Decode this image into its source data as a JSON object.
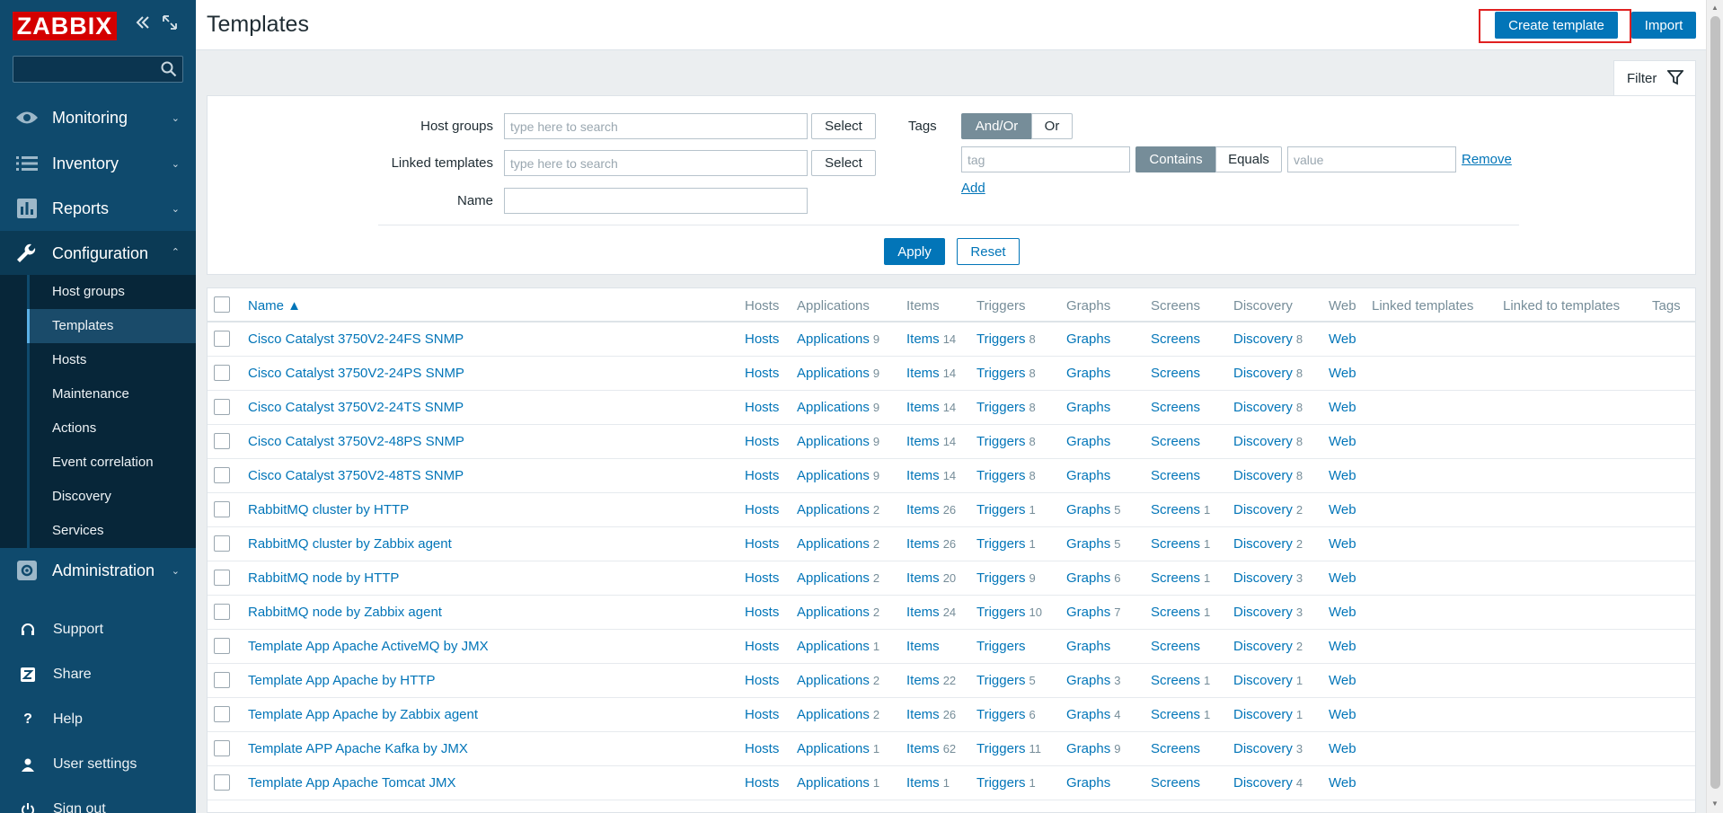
{
  "app": {
    "logo_text": "ZABBIX",
    "brand_color": "#d40000",
    "accent_color": "#0275b8"
  },
  "sidebar": {
    "collapse_icon": "double-chevron-left-icon",
    "kiosk_icon": "kiosk-mode-icon",
    "search_placeholder": "",
    "main_items": [
      {
        "label": "Monitoring",
        "icon": "eye-icon"
      },
      {
        "label": "Inventory",
        "icon": "list-icon"
      },
      {
        "label": "Reports",
        "icon": "bar-chart-icon"
      },
      {
        "label": "Configuration",
        "icon": "wrench-icon"
      },
      {
        "label": "Administration",
        "icon": "gear-icon"
      }
    ],
    "config_submenu": [
      "Host groups",
      "Templates",
      "Hosts",
      "Maintenance",
      "Actions",
      "Event correlation",
      "Discovery",
      "Services"
    ],
    "selected_submenu": "Templates",
    "bottom_items": [
      {
        "label": "Support",
        "icon": "headset-icon"
      },
      {
        "label": "Share",
        "icon": "share-z-icon"
      },
      {
        "label": "Help",
        "icon": "question-icon"
      },
      {
        "label": "User settings",
        "icon": "user-icon"
      },
      {
        "label": "Sign out",
        "icon": "power-icon"
      }
    ]
  },
  "header": {
    "title": "Templates",
    "create_label": "Create template",
    "import_label": "Import"
  },
  "filter": {
    "tab_label": "Filter",
    "host_groups_label": "Host groups",
    "host_groups_placeholder": "type here to search",
    "linked_templates_label": "Linked templates",
    "linked_templates_placeholder": "type here to search",
    "name_label": "Name",
    "name_value": "",
    "select_label": "Select",
    "tags_label": "Tags",
    "andor_label": "And/Or",
    "or_label": "Or",
    "tag_placeholder": "tag",
    "contains_label": "Contains",
    "equals_label": "Equals",
    "value_placeholder": "value",
    "remove_label": "Remove",
    "add_label": "Add",
    "apply_label": "Apply",
    "reset_label": "Reset"
  },
  "table": {
    "columns": {
      "name": "Name ▲",
      "hosts": "Hosts",
      "applications": "Applications",
      "items": "Items",
      "triggers": "Triggers",
      "graphs": "Graphs",
      "screens": "Screens",
      "discovery": "Discovery",
      "web": "Web",
      "linked_templates": "Linked templates",
      "linked_to_templates": "Linked to templates",
      "tags": "Tags"
    },
    "rows": [
      {
        "name": "Cisco Catalyst 3750V2-24FS SNMP",
        "hosts": "Hosts",
        "applications": "Applications",
        "applications_count": "9",
        "items": "Items",
        "items_count": "14",
        "triggers": "Triggers",
        "triggers_count": "8",
        "graphs": "Graphs",
        "graphs_count": "",
        "screens": "Screens",
        "screens_count": "",
        "discovery": "Discovery",
        "discovery_count": "8",
        "web": "Web"
      },
      {
        "name": "Cisco Catalyst 3750V2-24PS SNMP",
        "hosts": "Hosts",
        "applications": "Applications",
        "applications_count": "9",
        "items": "Items",
        "items_count": "14",
        "triggers": "Triggers",
        "triggers_count": "8",
        "graphs": "Graphs",
        "graphs_count": "",
        "screens": "Screens",
        "screens_count": "",
        "discovery": "Discovery",
        "discovery_count": "8",
        "web": "Web"
      },
      {
        "name": "Cisco Catalyst 3750V2-24TS SNMP",
        "hosts": "Hosts",
        "applications": "Applications",
        "applications_count": "9",
        "items": "Items",
        "items_count": "14",
        "triggers": "Triggers",
        "triggers_count": "8",
        "graphs": "Graphs",
        "graphs_count": "",
        "screens": "Screens",
        "screens_count": "",
        "discovery": "Discovery",
        "discovery_count": "8",
        "web": "Web"
      },
      {
        "name": "Cisco Catalyst 3750V2-48PS SNMP",
        "hosts": "Hosts",
        "applications": "Applications",
        "applications_count": "9",
        "items": "Items",
        "items_count": "14",
        "triggers": "Triggers",
        "triggers_count": "8",
        "graphs": "Graphs",
        "graphs_count": "",
        "screens": "Screens",
        "screens_count": "",
        "discovery": "Discovery",
        "discovery_count": "8",
        "web": "Web"
      },
      {
        "name": "Cisco Catalyst 3750V2-48TS SNMP",
        "hosts": "Hosts",
        "applications": "Applications",
        "applications_count": "9",
        "items": "Items",
        "items_count": "14",
        "triggers": "Triggers",
        "triggers_count": "8",
        "graphs": "Graphs",
        "graphs_count": "",
        "screens": "Screens",
        "screens_count": "",
        "discovery": "Discovery",
        "discovery_count": "8",
        "web": "Web"
      },
      {
        "name": "RabbitMQ cluster by HTTP",
        "hosts": "Hosts",
        "applications": "Applications",
        "applications_count": "2",
        "items": "Items",
        "items_count": "26",
        "triggers": "Triggers",
        "triggers_count": "1",
        "graphs": "Graphs",
        "graphs_count": "5",
        "screens": "Screens",
        "screens_count": "1",
        "discovery": "Discovery",
        "discovery_count": "2",
        "web": "Web"
      },
      {
        "name": "RabbitMQ cluster by Zabbix agent",
        "hosts": "Hosts",
        "applications": "Applications",
        "applications_count": "2",
        "items": "Items",
        "items_count": "26",
        "triggers": "Triggers",
        "triggers_count": "1",
        "graphs": "Graphs",
        "graphs_count": "5",
        "screens": "Screens",
        "screens_count": "1",
        "discovery": "Discovery",
        "discovery_count": "2",
        "web": "Web"
      },
      {
        "name": "RabbitMQ node by HTTP",
        "hosts": "Hosts",
        "applications": "Applications",
        "applications_count": "2",
        "items": "Items",
        "items_count": "20",
        "triggers": "Triggers",
        "triggers_count": "9",
        "graphs": "Graphs",
        "graphs_count": "6",
        "screens": "Screens",
        "screens_count": "1",
        "discovery": "Discovery",
        "discovery_count": "3",
        "web": "Web"
      },
      {
        "name": "RabbitMQ node by Zabbix agent",
        "hosts": "Hosts",
        "applications": "Applications",
        "applications_count": "2",
        "items": "Items",
        "items_count": "24",
        "triggers": "Triggers",
        "triggers_count": "10",
        "graphs": "Graphs",
        "graphs_count": "7",
        "screens": "Screens",
        "screens_count": "1",
        "discovery": "Discovery",
        "discovery_count": "3",
        "web": "Web"
      },
      {
        "name": "Template App Apache ActiveMQ by JMX",
        "hosts": "Hosts",
        "applications": "Applications",
        "applications_count": "1",
        "items": "Items",
        "items_count": "",
        "triggers": "Triggers",
        "triggers_count": "",
        "graphs": "Graphs",
        "graphs_count": "",
        "screens": "Screens",
        "screens_count": "",
        "discovery": "Discovery",
        "discovery_count": "2",
        "web": "Web"
      },
      {
        "name": "Template App Apache by HTTP",
        "hosts": "Hosts",
        "applications": "Applications",
        "applications_count": "2",
        "items": "Items",
        "items_count": "22",
        "triggers": "Triggers",
        "triggers_count": "5",
        "graphs": "Graphs",
        "graphs_count": "3",
        "screens": "Screens",
        "screens_count": "1",
        "discovery": "Discovery",
        "discovery_count": "1",
        "web": "Web"
      },
      {
        "name": "Template App Apache by Zabbix agent",
        "hosts": "Hosts",
        "applications": "Applications",
        "applications_count": "2",
        "items": "Items",
        "items_count": "26",
        "triggers": "Triggers",
        "triggers_count": "6",
        "graphs": "Graphs",
        "graphs_count": "4",
        "screens": "Screens",
        "screens_count": "1",
        "discovery": "Discovery",
        "discovery_count": "1",
        "web": "Web"
      },
      {
        "name": "Template APP Apache Kafka by JMX",
        "hosts": "Hosts",
        "applications": "Applications",
        "applications_count": "1",
        "items": "Items",
        "items_count": "62",
        "triggers": "Triggers",
        "triggers_count": "11",
        "graphs": "Graphs",
        "graphs_count": "9",
        "screens": "Screens",
        "screens_count": "",
        "discovery": "Discovery",
        "discovery_count": "3",
        "web": "Web"
      },
      {
        "name": "Template App Apache Tomcat JMX",
        "hosts": "Hosts",
        "applications": "Applications",
        "applications_count": "1",
        "items": "Items",
        "items_count": "1",
        "triggers": "Triggers",
        "triggers_count": "1",
        "graphs": "Graphs",
        "graphs_count": "",
        "screens": "Screens",
        "screens_count": "",
        "discovery": "Discovery",
        "discovery_count": "4",
        "web": "Web"
      }
    ]
  }
}
